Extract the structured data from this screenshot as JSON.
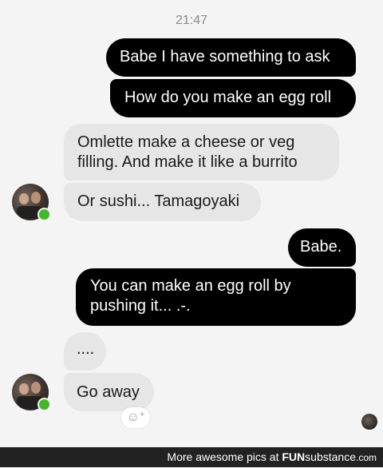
{
  "conversation": {
    "timestamp": "21:47",
    "messages": [
      {
        "text": "Babe I have something to ask",
        "from": "me"
      },
      {
        "text": "How do you make an egg roll",
        "from": "me"
      },
      {
        "text_lines": [
          "Omlette make a cheese or veg",
          "filling. And make it like a burrito"
        ],
        "from": "them"
      },
      {
        "text": "Or sushi... Tamagoyaki",
        "from": "them"
      },
      {
        "text": "Babe.",
        "from": "me"
      },
      {
        "text_lines": [
          "You can make an egg roll by",
          "pushing it... .-."
        ],
        "from": "me"
      },
      {
        "text": "....",
        "from": "them"
      },
      {
        "text": "Go away",
        "from": "them"
      }
    ],
    "react_icon": "smiley-plus-icon",
    "react_plus": "+",
    "contact_status": "online"
  },
  "colors": {
    "outgoing_bubble": "#000000",
    "incoming_bubble": "#e6e6e6",
    "background": "#f4f4f4",
    "online_dot": "#42b72a"
  },
  "watermark": {
    "prefix": "More awesome pics at",
    "brand_fun": "FUN",
    "brand_substance": "substance",
    "brand_com": ".com"
  }
}
